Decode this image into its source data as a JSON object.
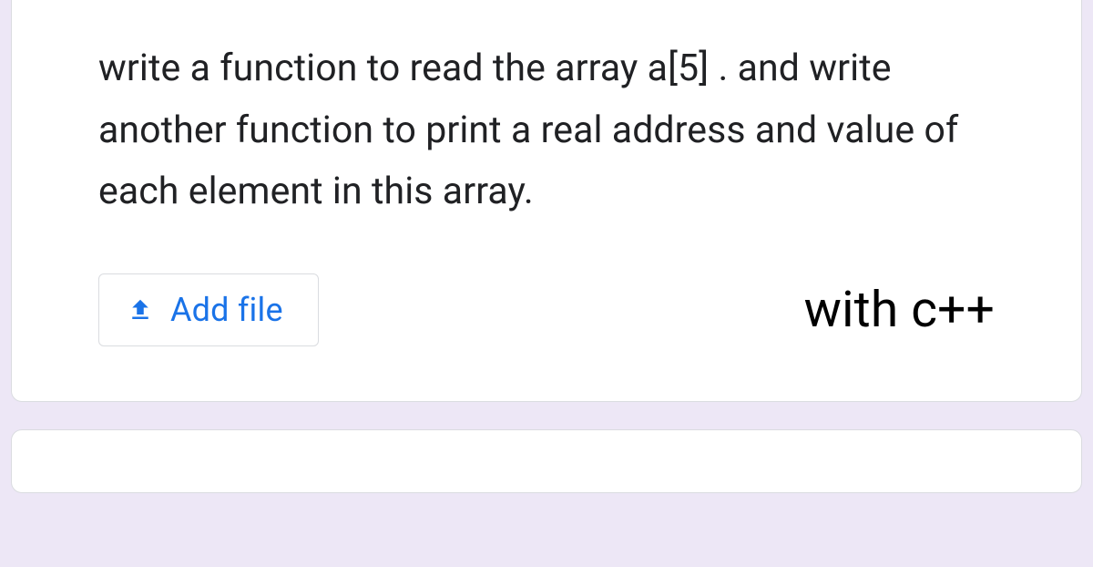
{
  "question": {
    "text": "write a function to read the array a[5] . and write another function to print a real address and value of each element in this array."
  },
  "upload": {
    "button_label": "Add file"
  },
  "annotation": {
    "text": "with c++"
  }
}
